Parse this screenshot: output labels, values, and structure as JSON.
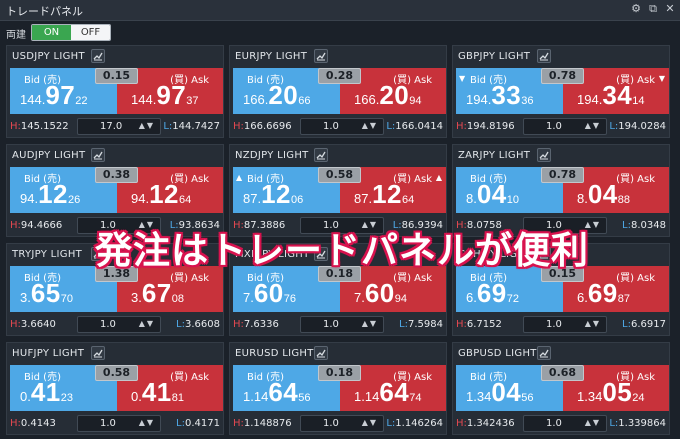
{
  "window": {
    "title": "トレードパネル",
    "controls": [
      "gear-icon",
      "popout-icon",
      "close-icon"
    ],
    "control_glyphs": [
      "⚙",
      "⧉",
      "✕"
    ]
  },
  "toolbar": {
    "label": "両建",
    "on_label": "ON",
    "off_label": "OFF",
    "selected": "ON"
  },
  "labels": {
    "bid": "Bid (売)",
    "ask": "(買) Ask",
    "high_prefix": "H:",
    "low_prefix": "L:",
    "stepper": "▲▼"
  },
  "colors": {
    "bid": "#4ea8e6",
    "ask": "#c8323b",
    "spread": "#9aa0a6",
    "on": "#3aa650",
    "overlay_stroke": "#d8144f"
  },
  "panels": [
    {
      "symbol": "USDJPY LIGHT",
      "spread": "0.15",
      "bid": {
        "a": "144.",
        "b": "97",
        "c": "22",
        "arrow": ""
      },
      "ask": {
        "a": "144.",
        "b": "97",
        "c": "37",
        "arrow": ""
      },
      "high": "145.1522",
      "low": "144.7427",
      "qty": "17.0"
    },
    {
      "symbol": "EURJPY LIGHT",
      "spread": "0.28",
      "bid": {
        "a": "166.",
        "b": "20",
        "c": "66",
        "arrow": ""
      },
      "ask": {
        "a": "166.",
        "b": "20",
        "c": "94",
        "arrow": ""
      },
      "high": "166.6696",
      "low": "166.0414",
      "qty": "1.0"
    },
    {
      "symbol": "GBPJPY LIGHT",
      "spread": "0.78",
      "bid": {
        "a": "194.",
        "b": "33",
        "c": "36",
        "arrow": "▼"
      },
      "ask": {
        "a": "194.",
        "b": "34",
        "c": "14",
        "arrow": "▼"
      },
      "high": "194.8196",
      "low": "194.0284",
      "qty": "1.0"
    },
    {
      "symbol": "AUDJPY LIGHT",
      "spread": "0.38",
      "bid": {
        "a": "94.",
        "b": "12",
        "c": "26",
        "arrow": ""
      },
      "ask": {
        "a": "94.",
        "b": "12",
        "c": "64",
        "arrow": ""
      },
      "high": "94.4666",
      "low": "93.8634",
      "qty": "1.0"
    },
    {
      "symbol": "NZDJPY LIGHT",
      "spread": "0.58",
      "bid": {
        "a": "87.",
        "b": "12",
        "c": "06",
        "arrow": "▲"
      },
      "ask": {
        "a": "87.",
        "b": "12",
        "c": "64",
        "arrow": "▲"
      },
      "high": "87.3886",
      "low": "86.9394",
      "qty": "1.0"
    },
    {
      "symbol": "ZARJPY LIGHT",
      "spread": "0.78",
      "bid": {
        "a": "8.",
        "b": "04",
        "c": "10",
        "arrow": ""
      },
      "ask": {
        "a": "8.",
        "b": "04",
        "c": "88",
        "arrow": ""
      },
      "high": "8.0758",
      "low": "8.0348",
      "qty": "1.0"
    },
    {
      "symbol": "TRYJPY LIGHT",
      "spread": "1.38",
      "bid": {
        "a": "3.",
        "b": "65",
        "c": "70",
        "arrow": ""
      },
      "ask": {
        "a": "3.",
        "b": "67",
        "c": "08",
        "arrow": ""
      },
      "high": "3.6640",
      "low": "3.6608",
      "qty": "1.0"
    },
    {
      "symbol": "MXNJPY LIGHT",
      "spread": "0.18",
      "bid": {
        "a": "7.",
        "b": "60",
        "c": "76",
        "arrow": ""
      },
      "ask": {
        "a": "7.",
        "b": "60",
        "c": "94",
        "arrow": ""
      },
      "high": "7.6336",
      "low": "7.5984",
      "qty": "1.0"
    },
    {
      "symbol": "CNHJPY LIGHT",
      "spread": "0.15",
      "bid": {
        "a": "6.",
        "b": "69",
        "c": "72",
        "arrow": ""
      },
      "ask": {
        "a": "6.",
        "b": "69",
        "c": "87",
        "arrow": ""
      },
      "high": "6.7152",
      "low": "6.6917",
      "qty": "1.0"
    },
    {
      "symbol": "HUFJPY LIGHT",
      "spread": "0.58",
      "bid": {
        "a": "0.",
        "b": "41",
        "c": "23",
        "arrow": ""
      },
      "ask": {
        "a": "0.",
        "b": "41",
        "c": "81",
        "arrow": ""
      },
      "high": "0.4143",
      "low": "0.4171",
      "qty": "1.0"
    },
    {
      "symbol": "EURUSD LIGHT",
      "spread": "0.18",
      "bid": {
        "a": "1.14",
        "b": "64",
        "c": "56",
        "arrow": ""
      },
      "ask": {
        "a": "1.14",
        "b": "64",
        "c": "74",
        "arrow": ""
      },
      "high": "1.148876",
      "low": "1.146264",
      "qty": "1.0"
    },
    {
      "symbol": "GBPUSD LIGHT",
      "spread": "0.68",
      "bid": {
        "a": "1.34",
        "b": "04",
        "c": "56",
        "arrow": ""
      },
      "ask": {
        "a": "1.34",
        "b": "05",
        "c": "24",
        "arrow": ""
      },
      "high": "1.342436",
      "low": "1.339864",
      "qty": "1.0"
    }
  ],
  "overlay_text": "発注はトレードパネルが便利"
}
